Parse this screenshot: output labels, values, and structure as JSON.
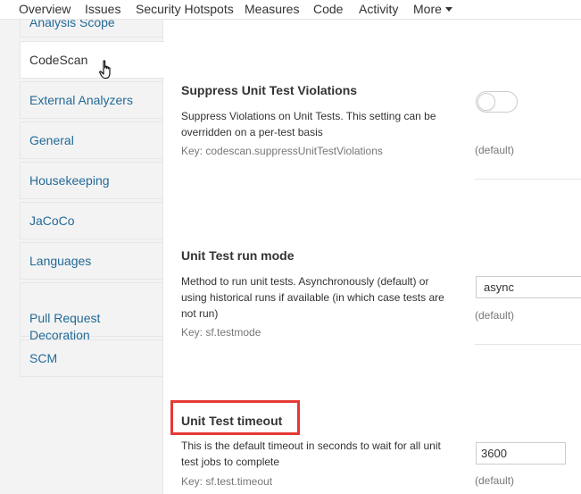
{
  "topnav": {
    "items": [
      "Overview",
      "Issues",
      "Security Hotspots",
      "Measures",
      "Code",
      "Activity",
      "More"
    ]
  },
  "sidebar": {
    "items": [
      {
        "label": "Analysis Scope"
      },
      {
        "label": "CodeScan"
      },
      {
        "label": "External Analyzers"
      },
      {
        "label": "General"
      },
      {
        "label": "Housekeeping"
      },
      {
        "label": "JaCoCo"
      },
      {
        "label": "Languages"
      },
      {
        "label": "Pull Request\nDecoration"
      },
      {
        "label": "SCM"
      }
    ],
    "active_index": 1
  },
  "settings": [
    {
      "title": "Suppress Unit Test Violations",
      "description": "Suppress Violations on Unit Tests. This setting can be overridden on a per-test basis",
      "key": "Key: codescan.suppressUnitTestViolations",
      "default_label": "(default)",
      "control": "toggle",
      "toggle_on": false
    },
    {
      "title": "Unit Test run mode",
      "description": "Method to run unit tests. Asynchronously (default) or using historical runs if available (in which case tests are not run)",
      "key": "Key: sf.testmode",
      "default_label": "(default)",
      "control": "select",
      "value": "async"
    },
    {
      "title": "Unit Test timeout",
      "description": "This is the default timeout in seconds to wait for all unit test jobs to complete",
      "key": "Key: sf.test.timeout",
      "default_label": "(default)",
      "control": "input",
      "value": "3600"
    }
  ],
  "colors": {
    "link": "#236a97",
    "sidebar_bg": "#f3f3f3",
    "highlight": "#e53935"
  }
}
